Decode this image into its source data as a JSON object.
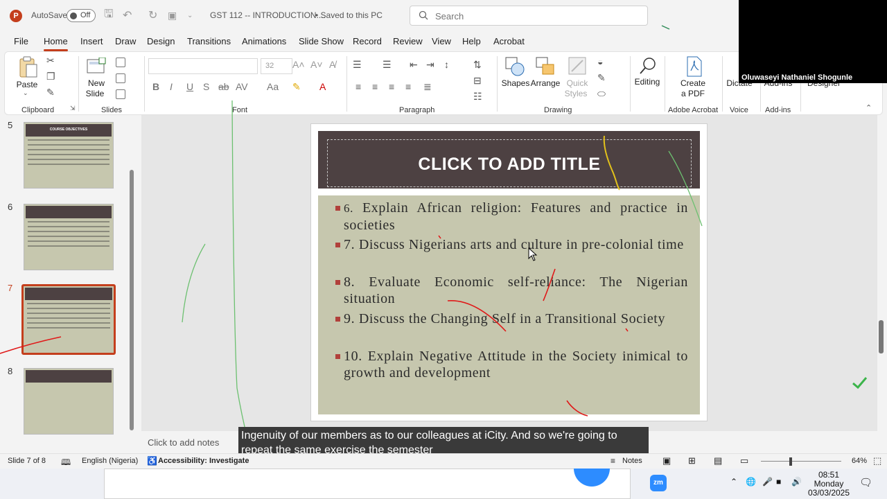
{
  "app": {
    "logo_letter": "P",
    "autosave_label": "AutoSave",
    "autosave_state": "Off",
    "document_title": "GST 112 -- INTRODUCTION....",
    "save_status": "• Saved to this PC",
    "search_placeholder": "Search"
  },
  "menu": [
    "File",
    "Home",
    "Insert",
    "Draw",
    "Design",
    "Transitions",
    "Animations",
    "Slide Show",
    "Record",
    "Review",
    "View",
    "Help",
    "Acrobat"
  ],
  "ribbon": {
    "paste": "Paste",
    "new_slide_line1": "New",
    "new_slide_line2": "Slide",
    "font_size": "32",
    "shapes": "Shapes",
    "arrange": "Arrange",
    "quick_styles_line1": "Quick",
    "quick_styles_line2": "Styles",
    "editing": "Editing",
    "create_pdf_line1": "Create",
    "create_pdf_line2": "a PDF",
    "dictate": "Dictate",
    "add_ins": "Add-ins",
    "designer": "Designer",
    "groups": {
      "clipboard": "Clipboard",
      "slides": "Slides",
      "font": "Font",
      "paragraph": "Paragraph",
      "drawing": "Drawing",
      "adobe_acrobat": "Adobe Acrobat",
      "voice": "Voice",
      "add_ins": "Add-ins"
    }
  },
  "participant_name": "Oluwaseyi Nathaniel Shogunle",
  "thumbnails": [
    {
      "number": "5",
      "title": "COURSE OBJECTIVES"
    },
    {
      "number": "6",
      "title": ""
    },
    {
      "number": "7",
      "title": ""
    },
    {
      "number": "8",
      "title": ""
    }
  ],
  "slide": {
    "title": "CLICK TO ADD TITLE",
    "bullets": [
      {
        "num": "6.",
        "text": "Explain African religion: Features and practice in societies"
      },
      {
        "num": "7.",
        "text": "Discuss Nigerians arts and culture in pre-colonial time"
      },
      {
        "num": "8.",
        "text": "Evaluate Economic self-reliance: The Nigerian situation"
      },
      {
        "num": "9.",
        "text": "Discuss the Changing Self in a Transitional Society"
      },
      {
        "num": "10.",
        "text": "Explain Negative Attitude in the Society inimical to growth and development"
      }
    ]
  },
  "notes_placeholder": "Click to add notes",
  "caption": {
    "line1": "Ingenuity of our members as to our colleagues at iCity. And so we're going to",
    "line2": "repeat the same exercise the semester"
  },
  "status": {
    "slide_counter": "Slide 7 of 8",
    "language": "English (Nigeria)",
    "accessibility": "Accessibility: Investigate",
    "notes": "Notes",
    "zoom": "64%"
  },
  "taskbar": {
    "time": "08:51",
    "day": "Monday",
    "date": "03/03/2025"
  },
  "colors": {
    "accent": "#c43e1c",
    "title_band": "#4d4142",
    "content_bg": "#c6c7ae",
    "bullet": "#b1403b"
  }
}
